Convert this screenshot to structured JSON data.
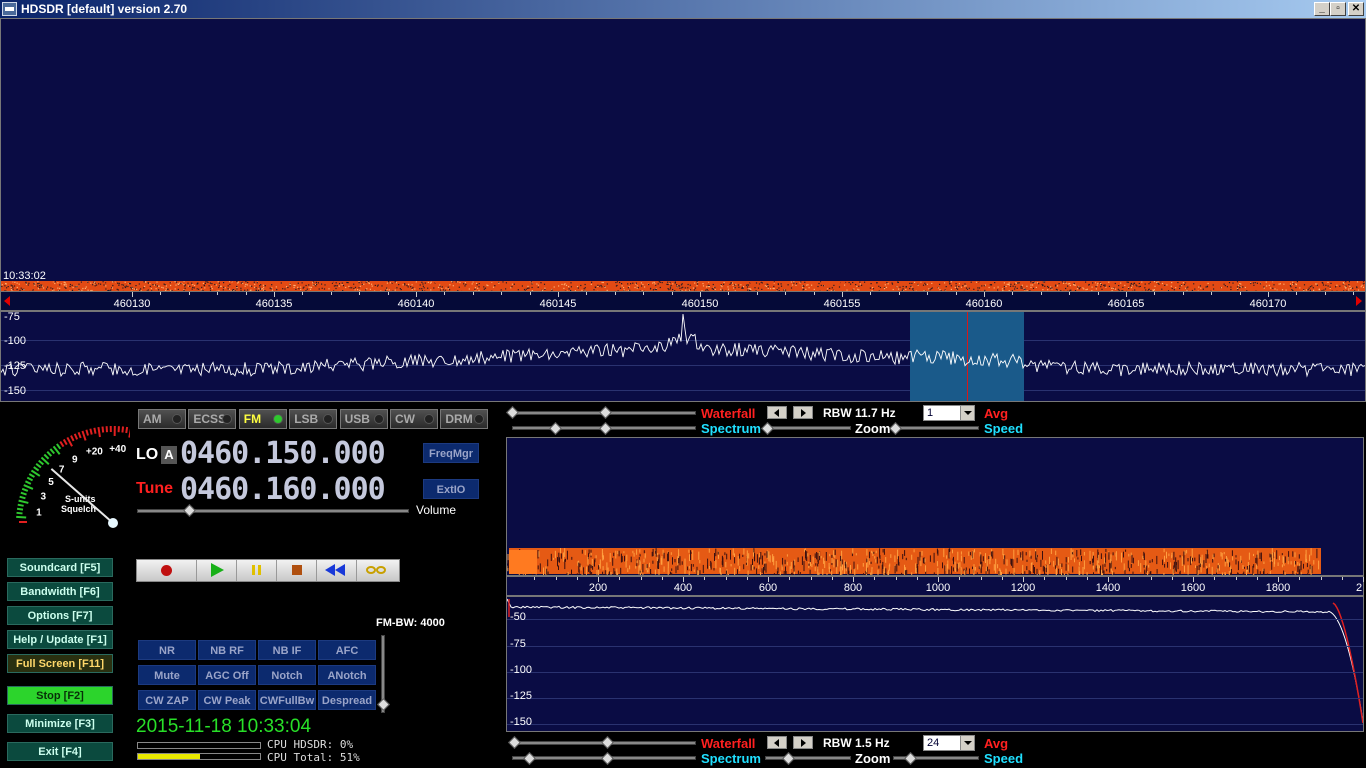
{
  "window": {
    "title": "HDSDR [default]  version 2.70",
    "min_glyph": "_",
    "restore_glyph": "▫",
    "close_glyph": "✕"
  },
  "rf_waterfall": {
    "timestamp": "10:33:02",
    "freq_ticks": [
      "460130",
      "460135",
      "460140",
      "460145",
      "460150",
      "460155",
      "460160",
      "460165",
      "460170"
    ],
    "db_ticks": [
      "-75",
      "-100",
      "-125",
      "-150"
    ],
    "band_color": "#e24a14"
  },
  "modes": [
    {
      "label": "AM",
      "active": false
    },
    {
      "label": "ECSS",
      "active": false
    },
    {
      "label": "FM",
      "active": true
    },
    {
      "label": "LSB",
      "active": false
    },
    {
      "label": "USB",
      "active": false
    },
    {
      "label": "CW",
      "active": false
    },
    {
      "label": "DRM",
      "active": false
    }
  ],
  "smeter": {
    "labels": [
      "1",
      "3",
      "5",
      "7",
      "9",
      "+20",
      "+40"
    ],
    "caption1": "S-units",
    "caption2": "Squelch"
  },
  "lo": {
    "label": "LO",
    "a_label": "A",
    "freq": "0460.150.000"
  },
  "tune": {
    "label": "Tune",
    "freq": "0460.160.000"
  },
  "freqmgr_label": "FreqMgr",
  "extio_label": "ExtIO",
  "volume_label": "Volume",
  "left_buttons": [
    "Soundcard  [F5]",
    "Bandwidth  [F6]",
    "Options  [F7]",
    "Help / Update  [F1]",
    "Full Screen  [F11]",
    "Stop       [F2]",
    "Minimize  [F3]",
    "Exit       [F4]"
  ],
  "dsp_buttons": [
    [
      "NR",
      "NB RF",
      "NB IF",
      "AFC"
    ],
    [
      "Mute",
      "AGC Off",
      "Notch",
      "ANotch"
    ],
    [
      "CW ZAP",
      "CW Peak",
      "CWFullBw",
      "Despread"
    ]
  ],
  "fm_bw": "FM-BW: 4000",
  "datetime": "2015-11-18 10:33:04",
  "cpu": {
    "hdsdr": "CPU HDSDR:  0%",
    "total": "CPU Total: 51%",
    "hdsdr_pct": 0,
    "total_pct": 51
  },
  "rf_controls": {
    "waterfall": "Waterfall",
    "spectrum": "Spectrum",
    "zoom": "Zoom",
    "speed": "Speed",
    "avg": "Avg",
    "rbw": "RBW  11.7 Hz",
    "combo": "1"
  },
  "af_controls": {
    "waterfall": "Waterfall",
    "spectrum": "Spectrum",
    "zoom": "Zoom",
    "speed": "Speed",
    "avg": "Avg",
    "rbw": "RBW    1.5 Hz",
    "combo": "24"
  },
  "af_display": {
    "freq_ticks": [
      "200",
      "400",
      "600",
      "800",
      "1000",
      "1200",
      "1400",
      "1600",
      "1800",
      "2"
    ],
    "db_ticks": [
      "-50",
      "-75",
      "-100",
      "-125",
      "-150"
    ]
  },
  "colors": {
    "accent_red": "#ff2020",
    "accent_cyan": "#20e0ff",
    "stop_green": "#2cd42c",
    "panel_bg": "#0a0c44"
  }
}
